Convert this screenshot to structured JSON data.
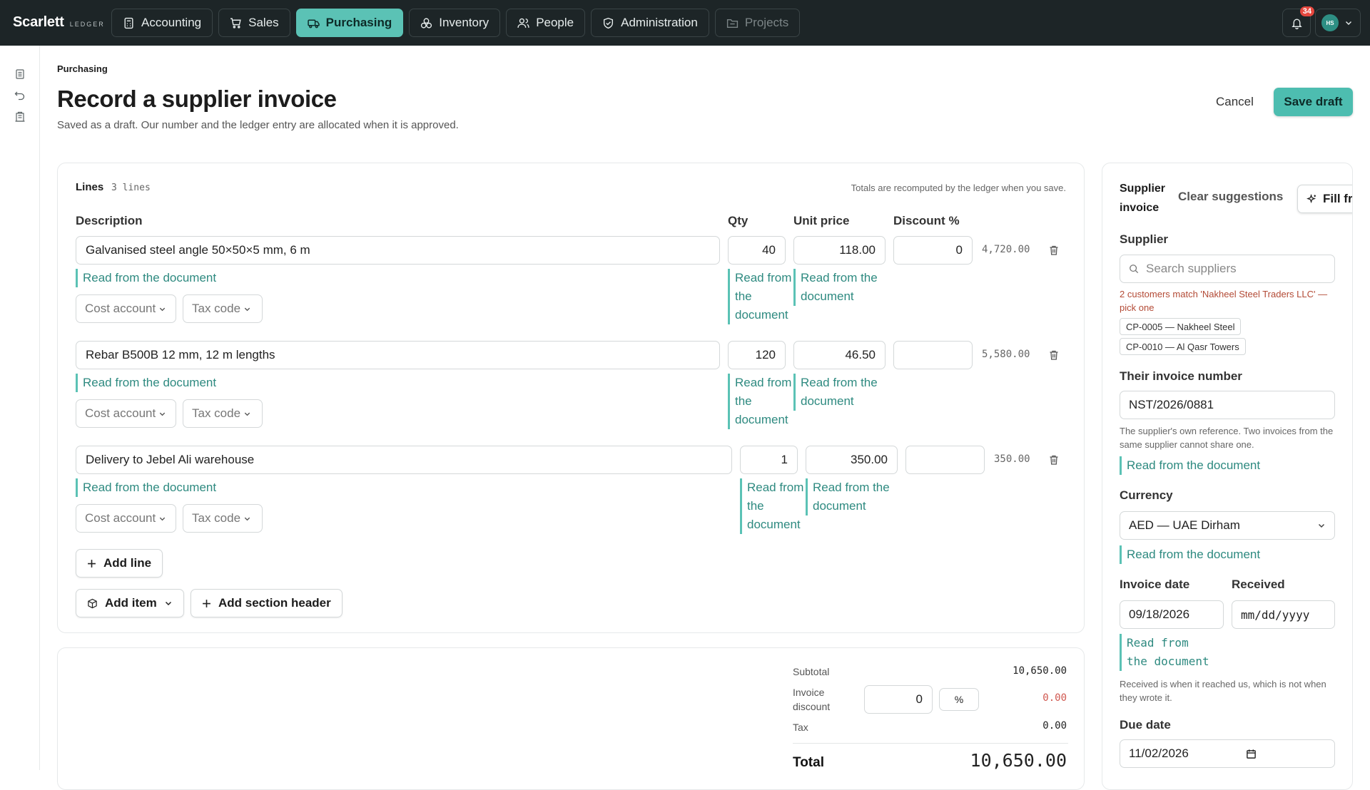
{
  "app": {
    "brand": "Scarlett",
    "brand_sub": "LEDGER",
    "notification_count": "34",
    "avatar_initials": "HS"
  },
  "nav": [
    {
      "label": "Accounting",
      "icon": "calculator-icon"
    },
    {
      "label": "Sales",
      "icon": "cart-icon"
    },
    {
      "label": "Purchasing",
      "icon": "truck-icon",
      "active": true
    },
    {
      "label": "Inventory",
      "icon": "boxes-icon"
    },
    {
      "label": "People",
      "icon": "people-icon"
    },
    {
      "label": "Administration",
      "icon": "shield-icon"
    },
    {
      "label": "Projects",
      "icon": "folder-icon",
      "disabled": true
    }
  ],
  "header": {
    "breadcrumb": "Purchasing",
    "title": "Record a supplier invoice",
    "subtitle": "Saved as a draft. Our number and the ledger entry are allocated when it is approved.",
    "cancel": "Cancel",
    "save": "Save draft"
  },
  "lines": {
    "heading": "Lines",
    "count": "3 lines",
    "note": "Totals are recomputed by the ledger when you save.",
    "columns": {
      "description": "Description",
      "qty": "Qty",
      "unit_price": "Unit price",
      "discount": "Discount %"
    },
    "hint": "Read from the document",
    "cost_account": "Cost account",
    "tax_code": "Tax code",
    "rows": [
      {
        "description": "Galvanised steel angle 50×50×5 mm, 6 m",
        "qty": "40",
        "unit_price": "118.00",
        "discount": "0",
        "amount": "4,720.00"
      },
      {
        "description": "Rebar B500B 12 mm, 12 m lengths",
        "qty": "120",
        "unit_price": "46.50",
        "discount": "",
        "amount": "5,580.00"
      },
      {
        "description": "Delivery to Jebel Ali warehouse",
        "qty": "1",
        "unit_price": "350.00",
        "discount": "",
        "amount": "350.00"
      }
    ],
    "add_line": "Add line",
    "add_item": "Add item",
    "add_section": "Add section header"
  },
  "totals": {
    "subtotal_label": "Subtotal",
    "subtotal": "10,650.00",
    "discount_label": "Invoice discount",
    "discount_input": "0",
    "discount_unit": "%",
    "discount_value": "0.00",
    "tax_label": "Tax",
    "tax": "0.00",
    "total_label": "Total",
    "total": "10,650.00"
  },
  "side": {
    "tab": "Supplier invoice",
    "clear": "Clear suggestions",
    "fill": "Fill from",
    "supplier_label": "Supplier",
    "supplier_placeholder": "Search suppliers",
    "supplier_warning": "2 customers match 'Nakheel Steel Traders LLC' — pick one",
    "matches": [
      "CP-0005 — Nakheel Steel",
      "CP-0010 — Al Qasr Towers"
    ],
    "invoice_no_label": "Their invoice number",
    "invoice_no": "NST/2026/0881",
    "invoice_no_help": "The supplier's own reference. Two invoices from the same supplier cannot share one.",
    "hint": "Read from the document",
    "currency_label": "Currency",
    "currency": "AED — UAE Dirham",
    "invoice_date_label": "Invoice date",
    "invoice_date": "09/18/2026",
    "received_label": "Received",
    "received_placeholder": "mm/dd/yyyy",
    "received_help": "Received is when it reached us, which is not when they wrote it.",
    "due_date_label": "Due date",
    "due_date": "11/02/2026"
  },
  "colors": {
    "accent": "#5bc2b5",
    "topbar": "#1d2527",
    "hint": "#2e8a80",
    "warning": "#b34a35",
    "alert": "#e5483f"
  }
}
